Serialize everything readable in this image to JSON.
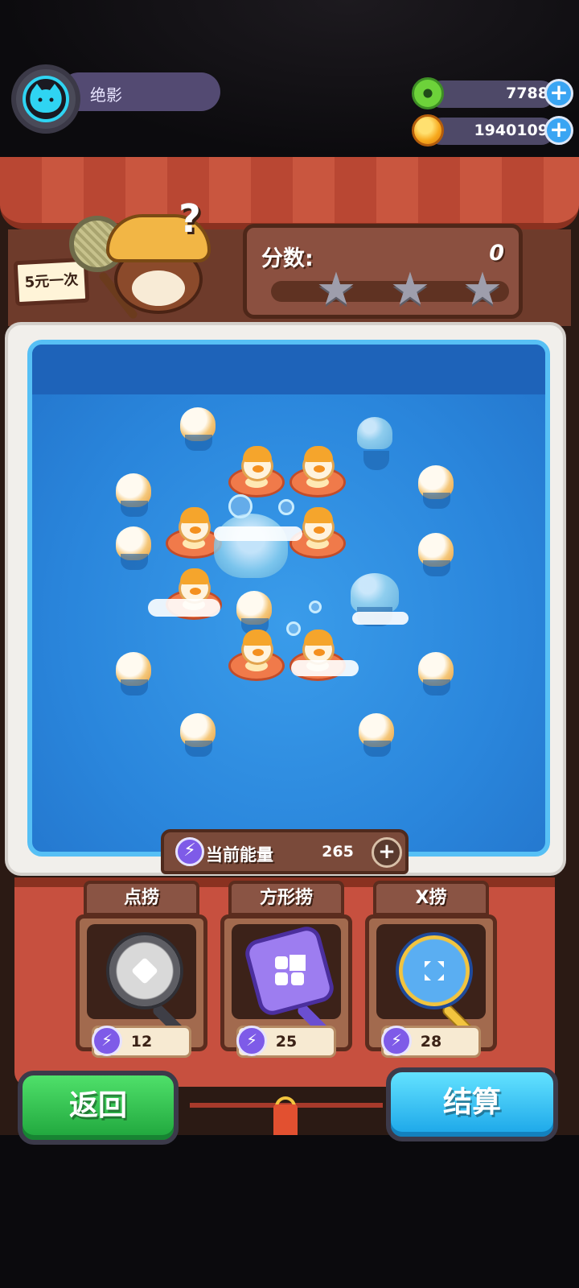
{
  "player": {
    "name": "绝影"
  },
  "currencies": [
    {
      "icon": "donut-icon",
      "value": "7788"
    },
    {
      "icon": "planet-icon",
      "value": "1940109"
    }
  ],
  "stall": {
    "sign": "5元一次"
  },
  "score": {
    "label": "分数:",
    "value": "0",
    "progress": 0,
    "stars_earned": 0,
    "stars_total": 3
  },
  "energy": {
    "label": "当前能量",
    "value": "265"
  },
  "tools": [
    {
      "name": "点捞",
      "cost": "12",
      "icon": "dot-net-icon"
    },
    {
      "name": "方形捞",
      "cost": "25",
      "icon": "square-net-icon"
    },
    {
      "name": "X捞",
      "cost": "28",
      "icon": "x-net-icon"
    }
  ],
  "buttons": {
    "back": "返回",
    "settle": "结算"
  },
  "colors": {
    "back_button": "#2fcf4f",
    "settle_button": "#2fbdf2",
    "energy_bolt": "#7e5be8",
    "pool": "#2a86dc"
  }
}
